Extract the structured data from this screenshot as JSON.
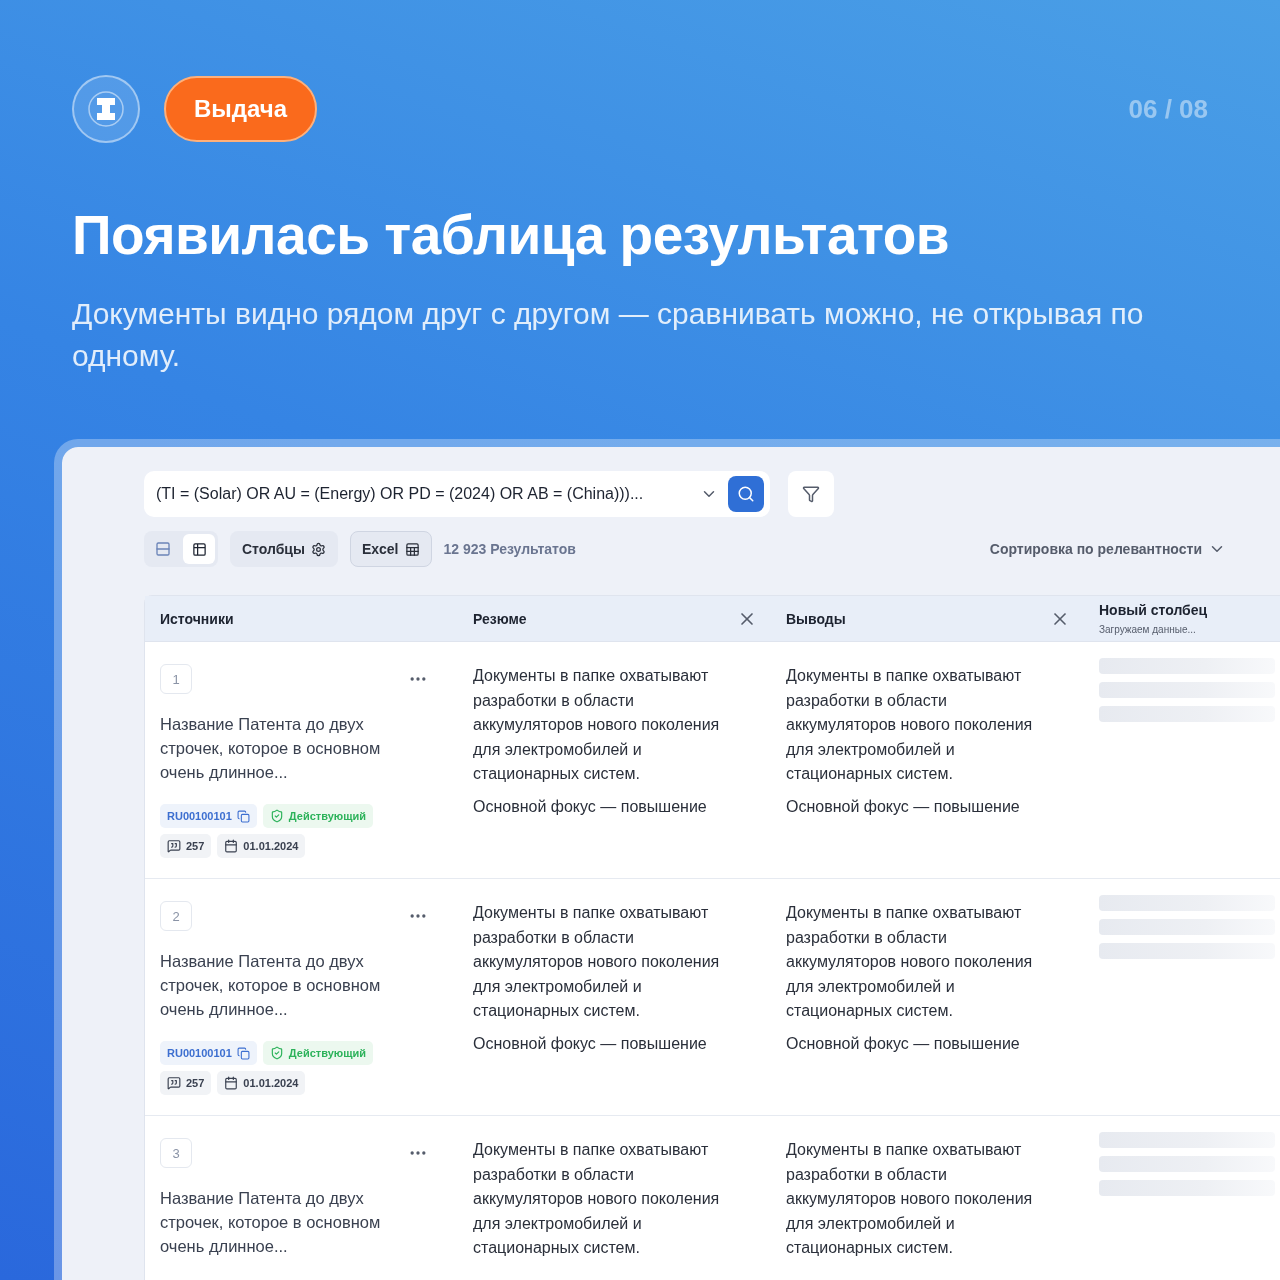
{
  "header": {
    "badge": "Выдача",
    "page_counter": "06 / 08"
  },
  "title": "Появилась таблица результатов",
  "subtitle": "Документы видно рядом друг с другом — сравнивать можно, не открывая по одному.",
  "search": {
    "value": "(TI = (Solar) OR AU = (Energy) OR PD = (2024) OR AB = (China)))..."
  },
  "toolbar": {
    "views": [
      {
        "kind": "list",
        "selected": false
      },
      {
        "kind": "table",
        "selected": true
      }
    ],
    "columns_button": "Столбцы",
    "excel_button": "Excel",
    "results": "12 923 Результатов",
    "sort": "Сортировка по релевантности"
  },
  "table": {
    "columns": [
      {
        "kind": "source",
        "label": "Источники",
        "closable": false
      },
      {
        "kind": "text",
        "label": "Резюме",
        "closable": true
      },
      {
        "kind": "text",
        "label": "Выводы",
        "closable": true
      },
      {
        "kind": "loading",
        "label": "Новый столбец",
        "subtitle": "Загружаем данные...",
        "closable": false
      }
    ],
    "rows": [
      {
        "number": "1",
        "title": "Название Патента до двух строчек, которое в основном очень длинное...",
        "patent_id": "RU00100101",
        "status": "Действующий",
        "citations": "257",
        "date": "01.01.2024",
        "summary": [
          "Документы в папке охватывают разработки в области аккумуляторов нового поколения для электромобилей и стационарных систем.",
          "Основной фокус — повышение"
        ],
        "conclusions": [
          "Документы в папке охватывают разработки в области аккумуляторов нового поколения для электромобилей и стационарных систем.",
          "Основной фокус — повышение"
        ]
      },
      {
        "number": "2",
        "title": "Название Патента до двух строчек, которое в основном очень длинное...",
        "patent_id": "RU00100101",
        "status": "Действующий",
        "citations": "257",
        "date": "01.01.2024",
        "summary": [
          "Документы в папке охватывают разработки в области аккумуляторов нового поколения для электромобилей и стационарных систем.",
          "Основной фокус — повышение"
        ],
        "conclusions": [
          "Документы в папке охватывают разработки в области аккумуляторов нового поколения для электромобилей и стационарных систем.",
          "Основной фокус — повышение"
        ]
      },
      {
        "number": "3",
        "title": "Название Патента до двух строчек, которое в основном очень длинное...",
        "summary": [
          "Документы в папке охватывают разработки в области аккумуляторов нового поколения для электромобилей и стационарных систем."
        ],
        "conclusions": [
          "Документы в папке охватывают разработки в области аккумуляторов нового поколения для электромобилей и стационарных систем."
        ]
      }
    ]
  }
}
